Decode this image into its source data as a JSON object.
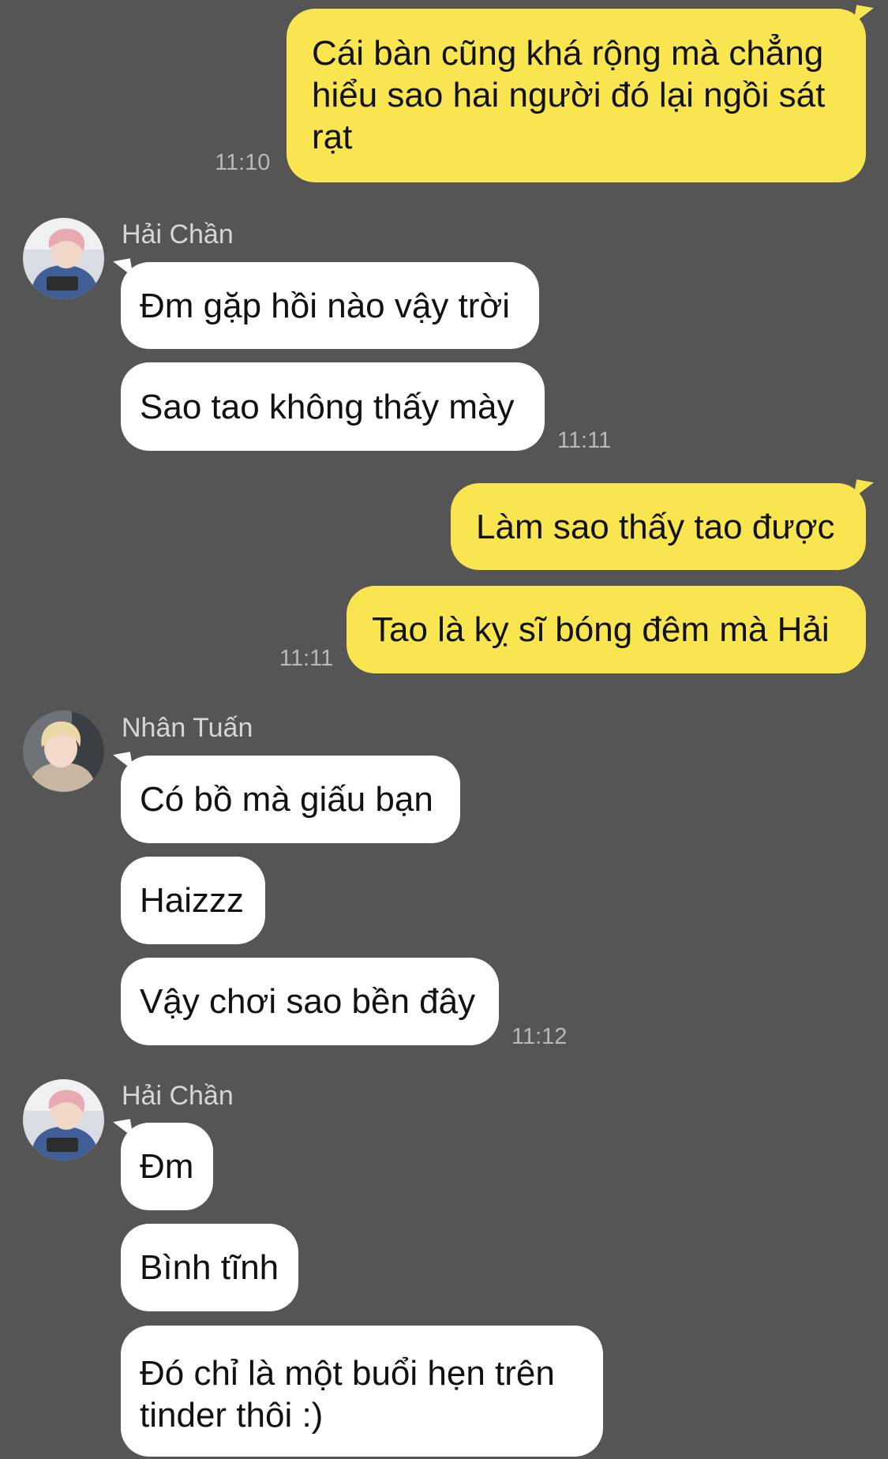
{
  "colors": {
    "background": "#555555",
    "my_bubble": "#f9e54f",
    "their_bubble": "#ffffff",
    "time_text": "#b9b9b9",
    "sender_text": "#d6d6d6"
  },
  "messages": {
    "m1": {
      "lines": [
        "Cái bàn cũng khá rộng mà chẳng",
        "hiểu sao hai người đó lại ngồi sát",
        "rạt"
      ],
      "time": "11:10"
    },
    "g1": {
      "sender": "Hải Chần",
      "avatar_icon": "avatar-pink-hair-photo",
      "b1": "Đm gặp hồi nào vậy trời",
      "b2": "Sao tao không thấy mày",
      "time": "11:11"
    },
    "m2": {
      "b1": "Làm sao thấy tao được",
      "b2": "Tao là kỵ sĩ bóng đêm mà Hải",
      "time": "11:11"
    },
    "g2": {
      "sender": "Nhân Tuấn",
      "avatar_icon": "avatar-blonde-hair-photo",
      "b1": "Có bồ mà giấu bạn",
      "b2": "Haizzz",
      "b3": "Vậy chơi sao bền đây",
      "time": "11:12"
    },
    "g3": {
      "sender": "Hải Chần",
      "avatar_icon": "avatar-pink-hair-photo",
      "b1": "Đm",
      "b2": "Bình tĩnh",
      "b3_lines": [
        "Đó chỉ là một buổi hẹn trên",
        "tinder thôi :)"
      ]
    }
  }
}
